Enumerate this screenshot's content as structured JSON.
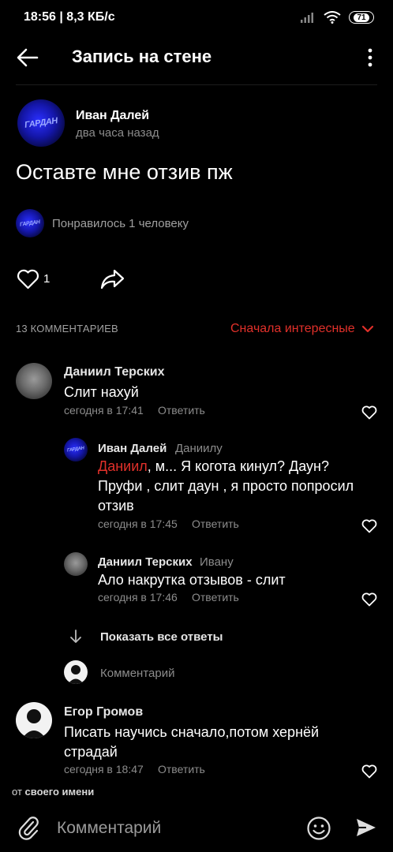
{
  "status_bar": {
    "time": "18:56",
    "speed": "8,3 КБ/с",
    "battery": "71"
  },
  "header": {
    "title": "Запись на стене",
    "back_icon": "arrow-left-icon",
    "more_icon": "more-vertical-icon"
  },
  "post": {
    "author": "Иван Далей",
    "time": "два часа назад",
    "avatar_text": "ГАРДАН",
    "text": "Оставте мне отзив пж",
    "liked_by": "Понравилось 1 человеку",
    "like_count": "1"
  },
  "comments_section": {
    "count_label": "13 КОММЕНТАРИЕВ",
    "sort_label": "Сначала интересные",
    "accent_color": "#e0302a"
  },
  "comments": [
    {
      "author": "Даниил Терских",
      "text": "Слит нахуй",
      "time": "сегодня в 17:41",
      "reply_label": "Ответить"
    },
    {
      "author": "Иван Далей",
      "to": "Даниилу",
      "mention": "Даниил",
      "text_after_mention": ", м... Я когота кинул? Даун?",
      "text_line2": "Пруфи , слит даун , я просто попросил",
      "text_line3": "отзив",
      "time": "сегодня в 17:45",
      "reply_label": "Ответить"
    },
    {
      "author": "Даниил Терских",
      "to": "Ивану",
      "text": "Ало накрутка отзывов - слит",
      "time": "сегодня в 17:46",
      "reply_label": "Ответить"
    },
    {
      "author": "Егор Громов",
      "text_line1": "Писать научись сначало,потом хернёй",
      "text_line2": "страдай",
      "time": "сегодня в 18:47",
      "reply_label": "Ответить"
    }
  ],
  "show_all_replies": "Показать все ответы",
  "reply_input_placeholder": "Комментарий",
  "bottom": {
    "hint_prefix": "от",
    "hint_bold": "своего имени",
    "input_placeholder": "Комментарий"
  }
}
